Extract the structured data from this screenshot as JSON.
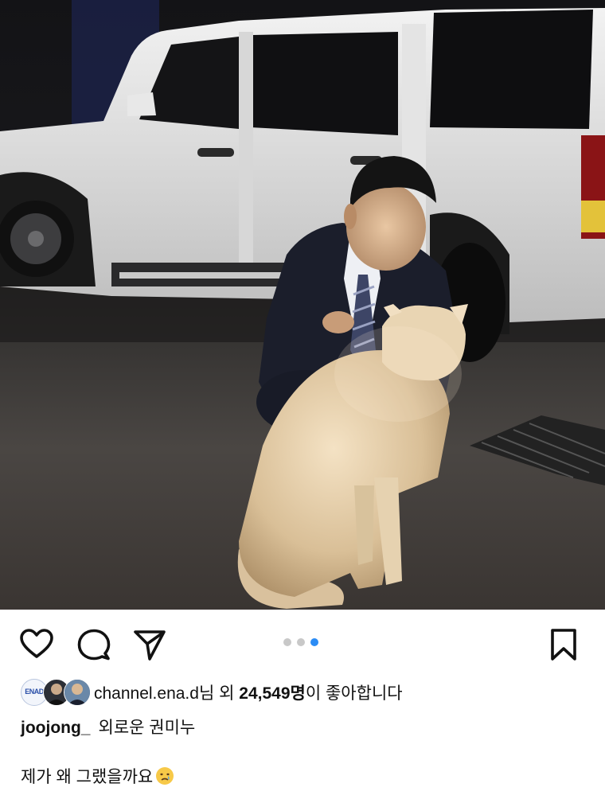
{
  "post": {
    "image_description_icon": "photo",
    "carousel": {
      "total": 3,
      "active_index": 2
    }
  },
  "actions": {
    "like_icon": "heart-icon",
    "comment_icon": "comment-bubble-icon",
    "share_icon": "paper-plane-icon",
    "save_icon": "bookmark-icon"
  },
  "likes": {
    "avatar1_text": "ENAD",
    "user": "channel.ena.d",
    "suffix1": "님 외 ",
    "count": "24,549명",
    "suffix2": "이 좋아합니다"
  },
  "caption": {
    "username": "joojong_",
    "line1": "외로운 권미누",
    "line2": "제가 왜 그랬을까요"
  },
  "colors": {
    "accent": "#2b8cf5",
    "inactive_dot": "#c8c8c8",
    "text": "#111111"
  }
}
